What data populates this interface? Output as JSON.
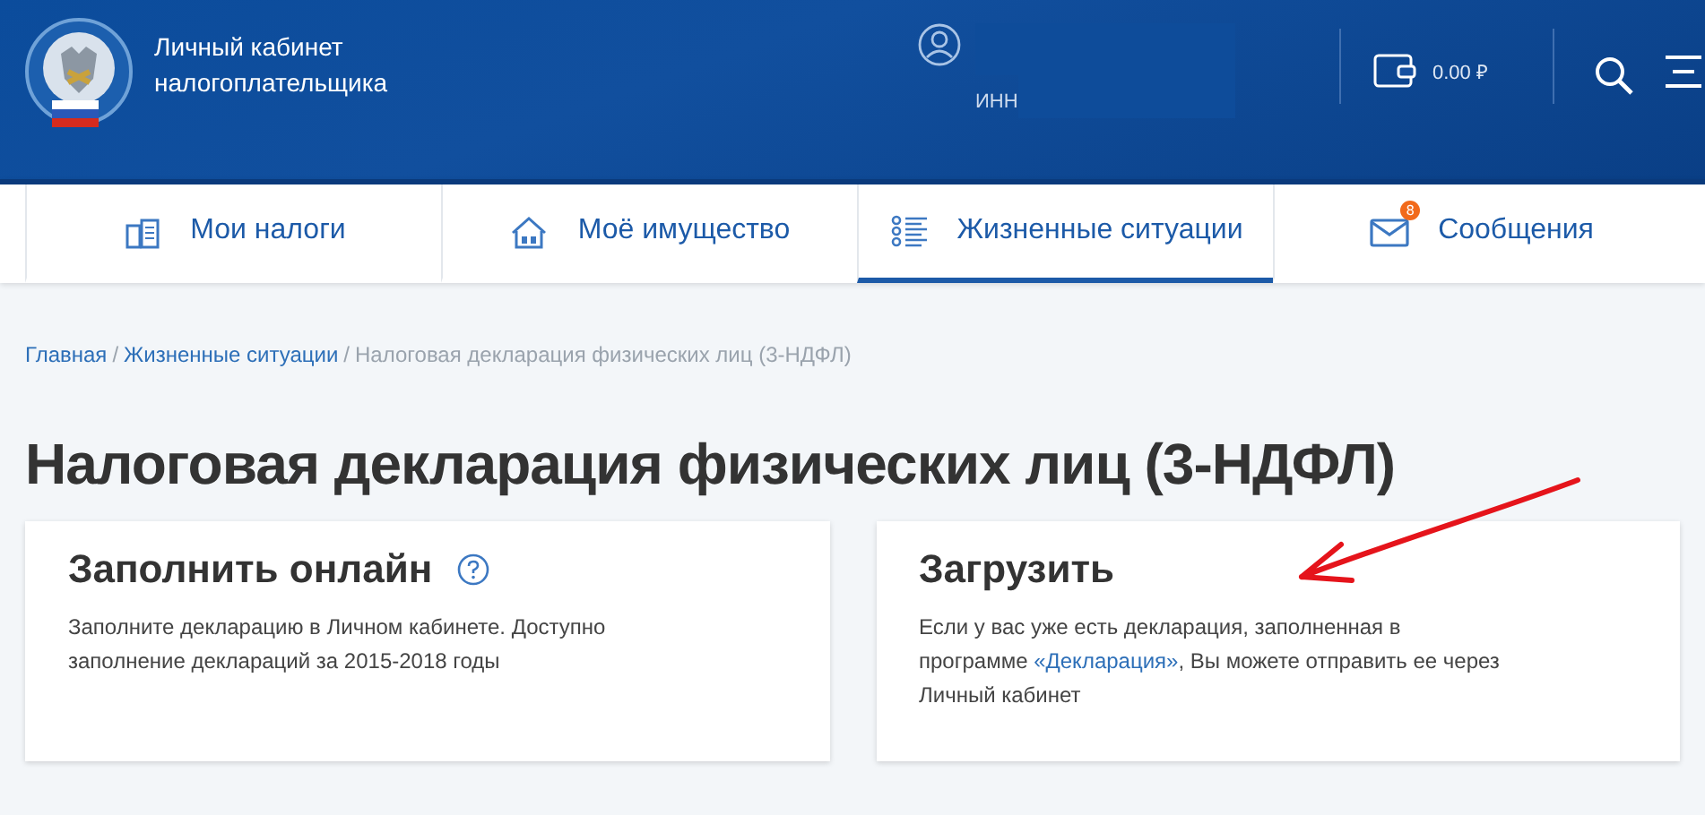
{
  "header": {
    "title_lines": [
      "Личный кабинет",
      "налогоплательщика"
    ],
    "user": {
      "inn_label": "ИНН"
    },
    "balance": "0.00 ₽"
  },
  "tabs": [
    {
      "label": "Мои налоги",
      "selected": false
    },
    {
      "label": "Моё имущество",
      "selected": false
    },
    {
      "label": "Жизненные ситуации",
      "selected": true
    },
    {
      "label": "Сообщения",
      "selected": false,
      "badge": "8"
    }
  ],
  "breadcrumb": [
    {
      "label": "Главная",
      "link": true
    },
    {
      "separator_before": "/",
      "label": "Жизненные ситуации",
      "link": true
    },
    {
      "separator_before": "/",
      "label": "Налоговая декларация физических лиц (3-НДФЛ)",
      "link": false
    }
  ],
  "page_title": "Налоговая декларация физических лиц (3-НДФЛ)",
  "cards": [
    {
      "title": "Заполнить онлайн",
      "help": true,
      "text": "Заполните декларацию в Личном кабинете. Доступно заполнение деклараций за 2015-2018 годы"
    },
    {
      "title": "Загрузить",
      "help": false,
      "text": "Если у вас уже есть декларация, заполненная в программе ",
      "link": "«Декларация»",
      "text_after": ", Вы можете отправить ее через Личный кабинет"
    }
  ]
}
